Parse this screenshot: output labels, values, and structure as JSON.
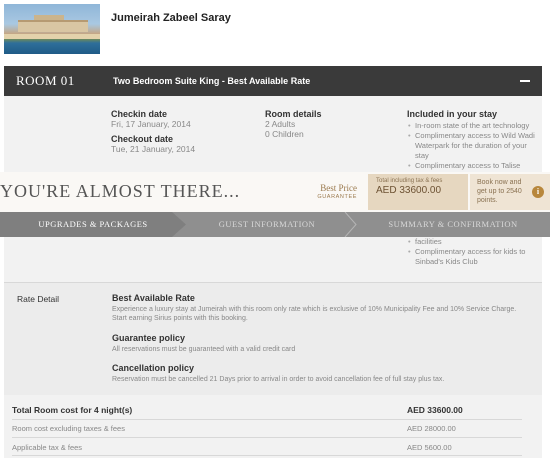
{
  "hotel": {
    "name": "Jumeirah Zabeel Saray",
    "thumbnail": "hotel-photo"
  },
  "room": {
    "number": "ROOM 01",
    "title": "Two Bedroom Suite King - Best Available Rate",
    "checkin_label": "Checkin date",
    "checkin_value": "Fri, 17 January, 2014",
    "checkout_label": "Checkout date",
    "checkout_value": "Tue, 21 January, 2014",
    "details_label": "Room details",
    "adults": "2 Adults",
    "children": "0 Children",
    "included_label": "Included in your stay",
    "included_top": [
      "In-room state of the art technology",
      "Complimentary access to Wild Wadi Waterpark for the duration of your stay",
      "Complimentary access to Talise"
    ],
    "included_bottom": [
      "facilities",
      "Complimentary access for kids to Sinbad's Kids Club"
    ]
  },
  "banner": {
    "headline": "YOU'RE ALMOST THERE...",
    "best_price": "Best Price",
    "guarantee": "GUARANTEE",
    "total_label": "Total including tax & fees",
    "total_price": "AED 33600.00",
    "points_text": "Book now and get up to 2540 points.",
    "info_icon": "i"
  },
  "steps": [
    "UPGRADES & PACKAGES",
    "GUEST INFORMATION",
    "SUMMARY & CONFIRMATION"
  ],
  "rate": {
    "section_label": "Rate Detail",
    "name": "Best Available Rate",
    "description": "Experience a luxury stay at Jumeirah with this room only rate which is exclusive of 10% Municipality Fee and 10% Service Charge. Start earning Sirius points with this booking.",
    "guarantee_title": "Guarantee policy",
    "guarantee_text": "All reservations must be guaranteed with a valid credit card",
    "cancel_title": "Cancellation policy",
    "cancel_text": "Reservation must be cancelled 21 Days prior to arrival in order to avoid cancellation fee of full stay plus tax."
  },
  "totals": {
    "total_label": "Total Room cost for 4 night(s)",
    "total_amount": "AED 33600.00",
    "room_cost_label": "Room cost excluding taxes & fees",
    "room_cost_amount": "AED 28000.00",
    "tax_label": "Applicable tax & fees",
    "tax_amount": "AED 5600.00"
  },
  "colors": {
    "room_bar": "#3a3a3a",
    "gold": "#9b7a4e",
    "steps_active": "#7f7f7f",
    "steps_inactive": "#8f8f8f"
  }
}
